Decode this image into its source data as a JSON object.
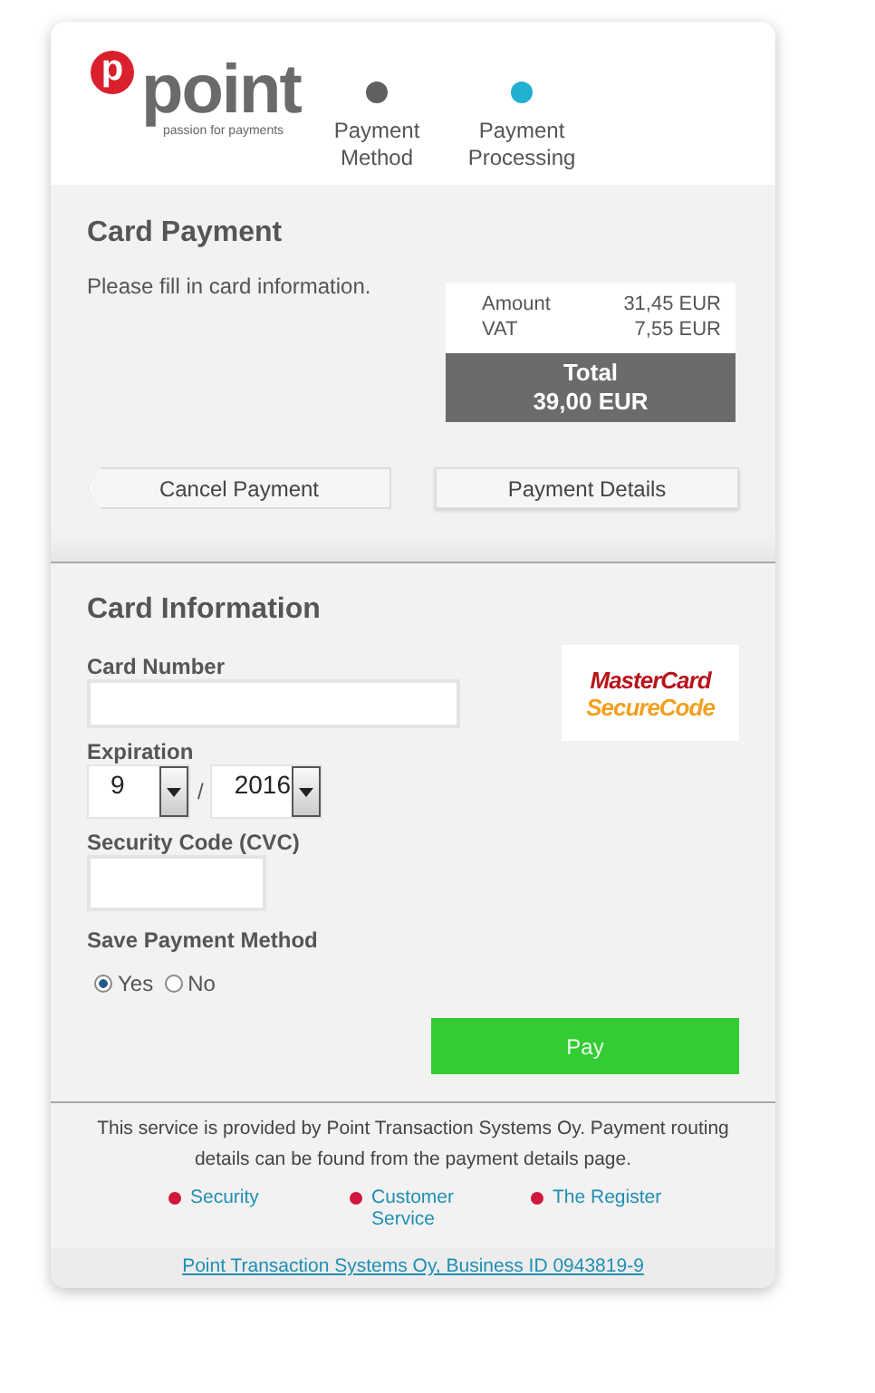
{
  "logo": {
    "mark": "p",
    "name": "point",
    "tagline": "passion for payments"
  },
  "steps": [
    {
      "label": "Payment Method",
      "selected": false
    },
    {
      "label": "Payment Processing",
      "selected": true
    }
  ],
  "card_payment": {
    "title": "Card Payment",
    "instruction": "Please fill in card information.",
    "summary": [
      {
        "label": "Amount",
        "value": "31,45 EUR"
      },
      {
        "label": "VAT",
        "value": "7,55 EUR"
      }
    ],
    "total_label": "Total",
    "total_value": "39,00 EUR",
    "buttons": [
      {
        "label": "Cancel Payment",
        "kind": "back"
      },
      {
        "label": "Payment Details",
        "kind": "plain"
      }
    ]
  },
  "card_information": {
    "title": "Card Information",
    "brand_line_1": "MasterCard",
    "brand_line_2": "SecureCode",
    "card_number_label": "Card Number",
    "expiration_label": "Expiration",
    "month": "9",
    "separator": "/",
    "year": "2016",
    "cvc_label": "Security Code (CVC)",
    "save_label": "Save Payment Method",
    "save_options": [
      {
        "label": "Yes",
        "selected": true
      },
      {
        "label": "No",
        "selected": false
      }
    ],
    "pay_button": "Pay"
  },
  "footer": {
    "text": "This service is provided by Point Transaction Systems Oy. Payment routing details can be found from the payment details page.",
    "links": [
      "Security",
      "Customer Service",
      "The Register"
    ],
    "business_link": "Point Transaction Systems Oy, Business ID 0943819-9"
  }
}
